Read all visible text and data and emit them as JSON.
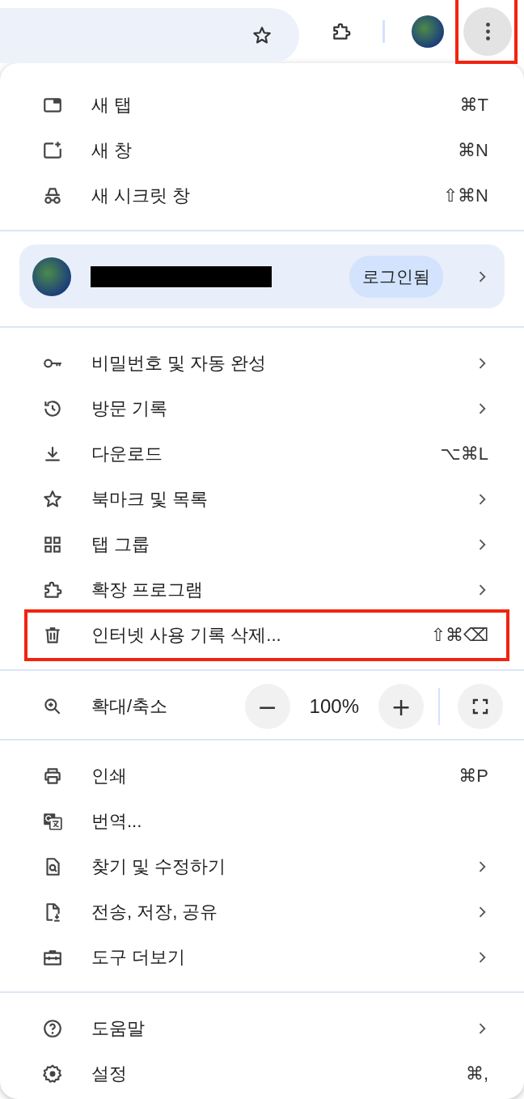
{
  "toolbar": {
    "menu_button": {
      "pressed": true,
      "highlighted": true
    }
  },
  "sections": [
    {
      "kind": "items",
      "items": [
        {
          "label": "새 탭",
          "shortcut": "⌘T",
          "submenu": false,
          "highlighted": false
        },
        {
          "label": "새 창",
          "shortcut": "⌘N",
          "submenu": false,
          "highlighted": false
        },
        {
          "label": "새 시크릿 창",
          "shortcut": "⇧⌘N",
          "submenu": false,
          "highlighted": false
        }
      ]
    },
    {
      "kind": "profile",
      "badge": "로그인됨",
      "name_redacted": true,
      "submenu": true
    },
    {
      "kind": "items",
      "items": [
        {
          "label": "비밀번호 및 자동 완성",
          "submenu": true,
          "highlighted": false
        },
        {
          "label": "방문 기록",
          "submenu": true,
          "highlighted": false
        },
        {
          "label": "다운로드",
          "shortcut": "⌥⌘L",
          "submenu": false,
          "highlighted": false
        },
        {
          "label": "북마크 및 목록",
          "submenu": true,
          "highlighted": false
        },
        {
          "label": "탭 그룹",
          "submenu": true,
          "highlighted": false
        },
        {
          "label": "확장 프로그램",
          "submenu": true,
          "highlighted": false
        },
        {
          "label": "인터넷 사용 기록 삭제...",
          "shortcut": "⇧⌘⌫",
          "submenu": false,
          "highlighted": true
        }
      ]
    },
    {
      "kind": "zoom",
      "label": "확대/축소",
      "minus": "−",
      "value": "100%",
      "plus": "+"
    },
    {
      "kind": "items",
      "items": [
        {
          "label": "인쇄",
          "shortcut": "⌘P",
          "submenu": false,
          "highlighted": false
        },
        {
          "label": "번역...",
          "submenu": false,
          "highlighted": false
        },
        {
          "label": "찾기 및 수정하기",
          "submenu": true,
          "highlighted": false
        },
        {
          "label": "전송, 저장, 공유",
          "submenu": true,
          "highlighted": false
        },
        {
          "label": "도구 더보기",
          "submenu": true,
          "highlighted": false
        }
      ]
    },
    {
      "kind": "items",
      "items": [
        {
          "label": "도움말",
          "submenu": true,
          "highlighted": false
        },
        {
          "label": "설정",
          "shortcut": "⌘,",
          "submenu": false,
          "highlighted": false
        }
      ]
    }
  ]
}
